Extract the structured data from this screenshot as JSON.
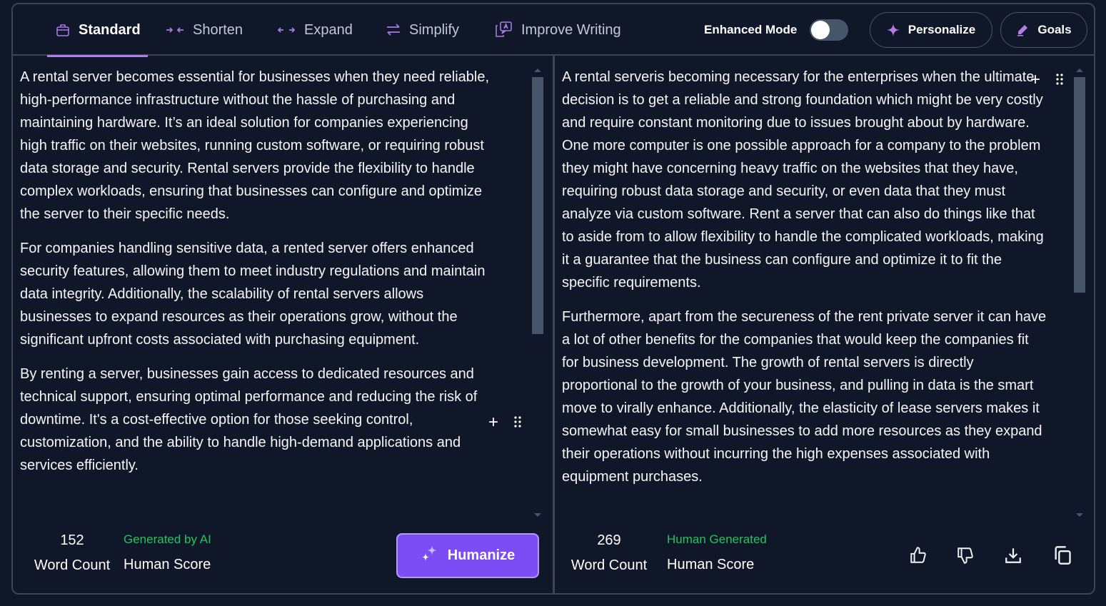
{
  "tabs": [
    {
      "label": "Standard",
      "icon": "briefcase-icon",
      "active": true
    },
    {
      "label": "Shorten",
      "icon": "arrows-inward-icon",
      "active": false
    },
    {
      "label": "Expand",
      "icon": "arrows-outward-icon",
      "active": false
    },
    {
      "label": "Simplify",
      "icon": "swap-arrows-icon",
      "active": false
    },
    {
      "label": "Improve Writing",
      "icon": "improve-writing-icon",
      "active": false
    }
  ],
  "enhanced_mode": {
    "label": "Enhanced Mode",
    "on": false
  },
  "personalize_label": "Personalize",
  "goals_label": "Goals",
  "input": {
    "paragraphs": [
      "A rental server becomes essential for businesses when they need reliable, high-performance infrastructure without the hassle of purchasing and maintaining hardware. It’s an ideal solution for companies experiencing high traffic on their websites, running custom software, or requiring robust data storage and security. Rental servers provide the flexibility to handle complex workloads, ensuring that businesses can configure and optimize the server to their specific needs.",
      "For companies handling sensitive data, a rented server offers enhanced security features, allowing them to meet industry regulations and maintain data integrity. Additionally, the scalability of rental servers allows businesses to expand resources as their operations grow, without the significant upfront costs associated with purchasing equipment.",
      "By renting a server, businesses gain access to dedicated resources and technical support, ensuring optimal performance and reducing the risk of downtime. It's a cost-effective option for those seeking control, customization, and the ability to handle high-demand applications and services efficiently."
    ],
    "word_count": "152",
    "word_count_label": "Word Count",
    "human_score": "Generated by AI",
    "human_score_label": "Human Score",
    "humanize_label": "Humanize"
  },
  "output": {
    "paragraphs": [
      "A rental serveris becoming necessary for the enterprises when the ultimate decision is to get a reliable and strong foundation which might be very costly and require constant monitoring due to issues brought about by hardware. One more computer is one possible approach for a company to the problem they might have concerning heavy traffic on the websites that they have, requiring robust data storage and security, or even data that they must analyze via custom software. Rent a server that can also do things like that to aside from to allow flexibility to handle the complicated workloads, making it a guarantee that the business can configure and optimize it to fit the specific requirements.",
      "Furthermore, apart from the secureness of the rent private server it can have a lot of other benefits for the companies that would keep the companies fit for business development. The growth of rental servers is directly proportional to the growth of your business, and pulling in data is the smart move to virally enhance. Additionally, the elasticity of lease servers makes it somewhat easy for small businesses to add more resources as they expand their operations without incurring the high expenses associated with equipment purchases."
    ],
    "word_count": "269",
    "word_count_label": "Word Count",
    "human_score": "Human Generated",
    "human_score_label": "Human Score"
  },
  "colors": {
    "accent": "#7c4df5",
    "tab_indicator": "#b57be8",
    "status_green": "#22c55e",
    "background": "#0f1729"
  }
}
